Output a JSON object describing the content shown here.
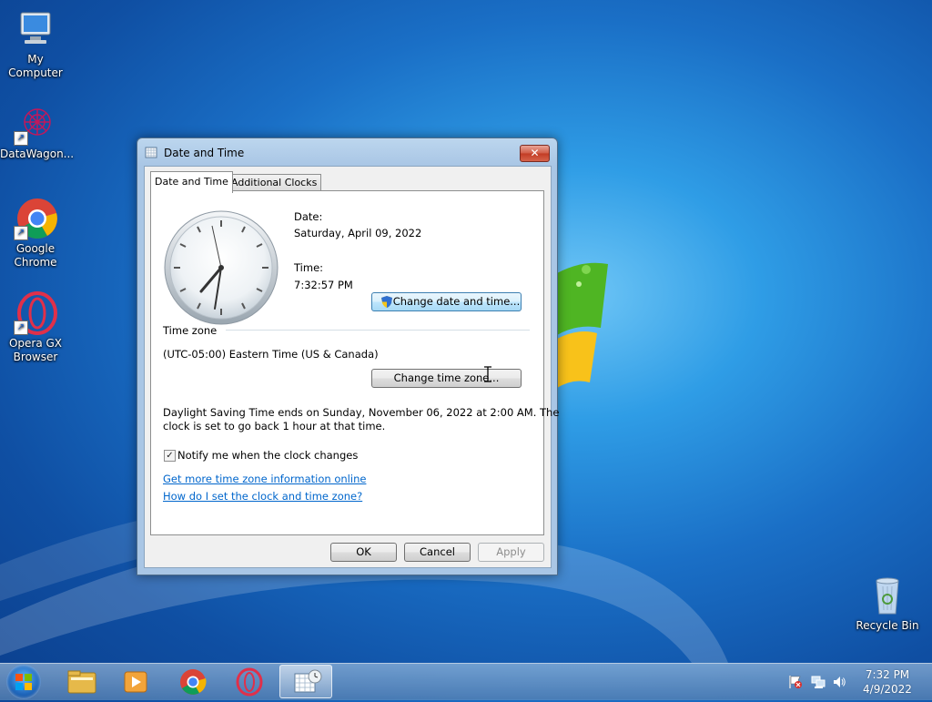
{
  "desktop": {
    "icons": [
      {
        "label": "My Computer",
        "icon": "computer-icon"
      },
      {
        "label": "DataWagon...",
        "icon": "datawagon-icon"
      },
      {
        "label": "Google Chrome",
        "icon": "chrome-icon"
      },
      {
        "label": "Opera GX Browser",
        "icon": "opera-gx-icon"
      },
      {
        "label": "Recycle Bin",
        "icon": "recycle-bin-icon"
      }
    ]
  },
  "dialog": {
    "title": "Date and Time",
    "close_label": "✕",
    "tabs": [
      {
        "label": "Date and Time",
        "active": true
      },
      {
        "label": "Additional Clocks",
        "active": false
      }
    ],
    "date_label": "Date:",
    "date_value": "Saturday, April 09, 2022",
    "time_label": "Time:",
    "time_value": "7:32:57 PM",
    "change_datetime_button": "Change date and time...",
    "timezone_header": "Time zone",
    "timezone_value": "(UTC-05:00) Eastern Time (US & Canada)",
    "change_timezone_button": "Change time zone...",
    "dst_line1": "Daylight Saving Time ends on Sunday, November 06, 2022 at 2:00 AM. The",
    "dst_line2": "clock is set to go back 1 hour at that time.",
    "notify_checkbox_label": "Notify me when the clock changes",
    "notify_checked": true,
    "link_more_info": "Get more time zone information online",
    "link_how_to": "How do I set the clock and time zone?",
    "ok_button": "OK",
    "cancel_button": "Cancel",
    "apply_button": "Apply"
  },
  "taskbar": {
    "pinned": [
      "windows-explorer-icon",
      "media-player-icon",
      "chrome-icon",
      "opera-gx-icon",
      "date-time-icon"
    ],
    "clock_time": "7:32 PM",
    "clock_date": "4/9/2022"
  },
  "colors": {
    "accent": "#3c7fb1",
    "link": "#0066cc",
    "close_red": "#c23b24"
  }
}
